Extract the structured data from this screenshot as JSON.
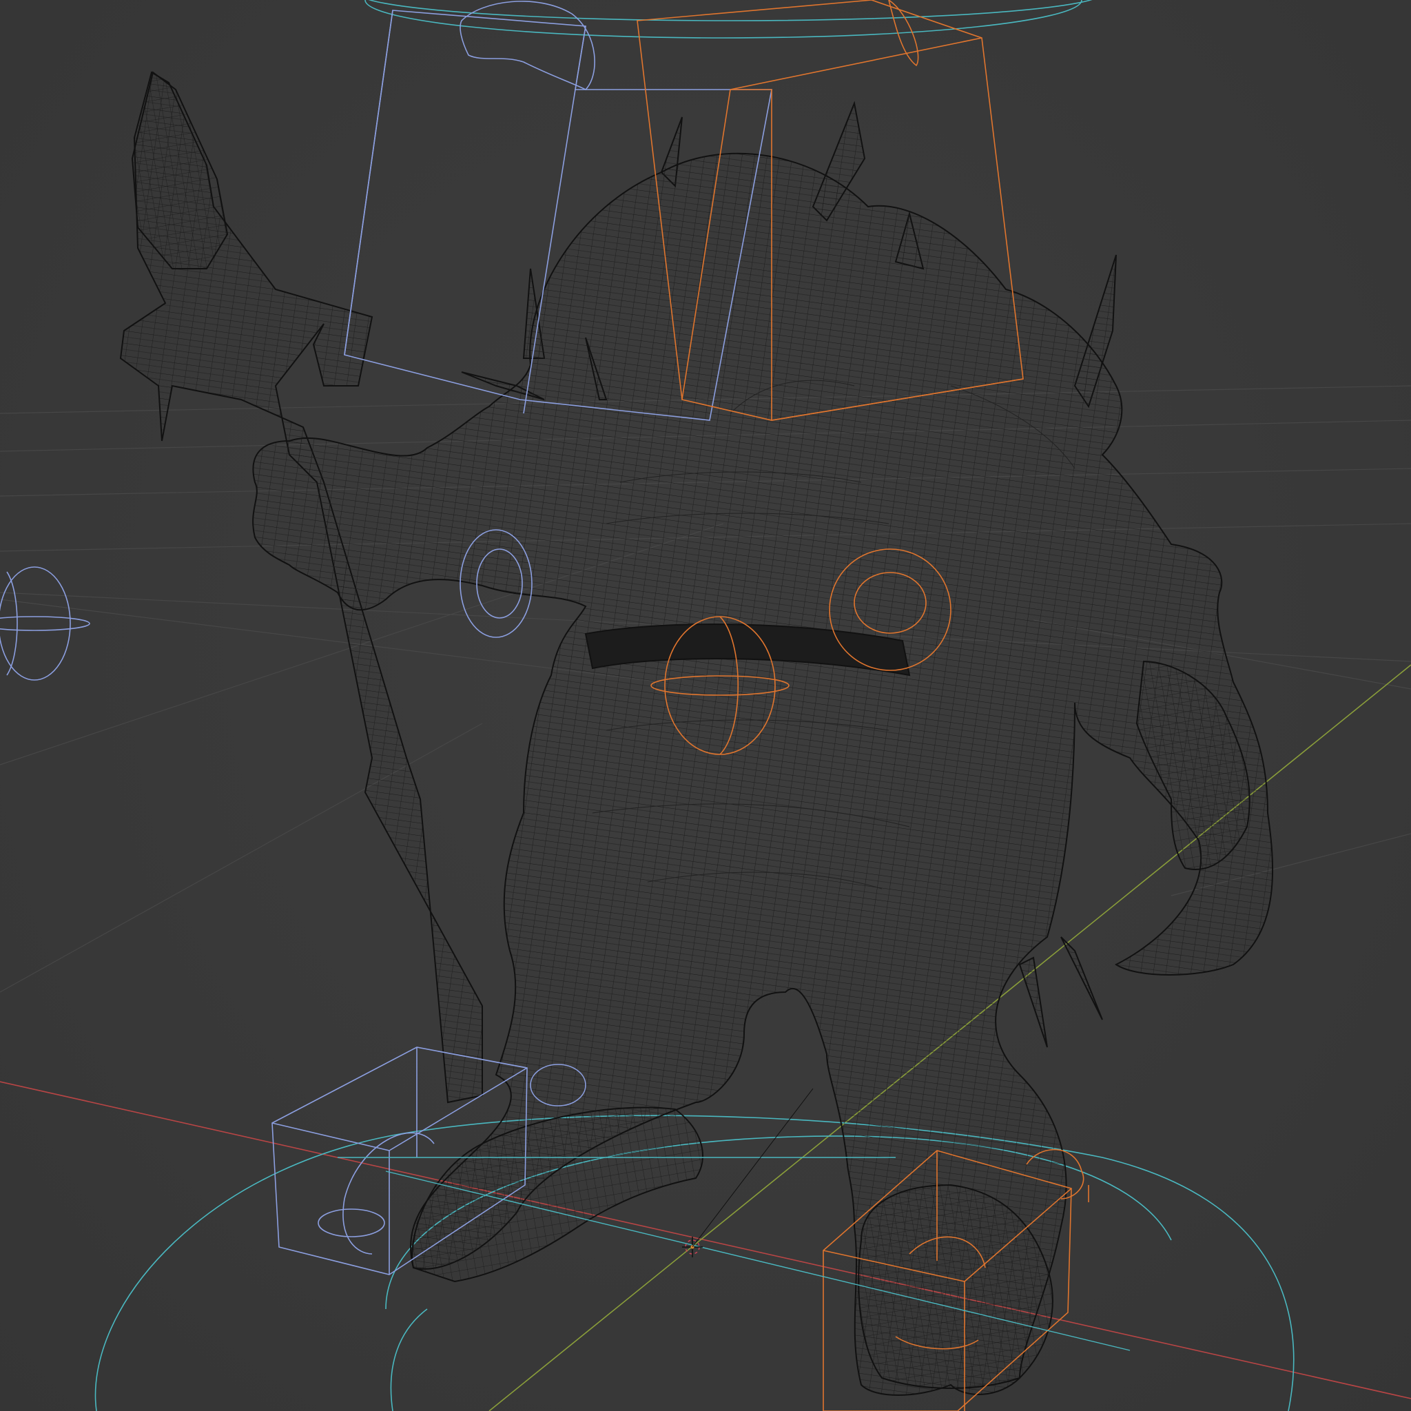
{
  "viewport": {
    "background": "#393939",
    "grid_color": "#4a4a4a",
    "axis_x_color": "#c24a4a",
    "axis_y_color": "#8ea33a"
  },
  "rig": {
    "left_controls_color": "#8c9fe0",
    "right_controls_color": "#e0752e",
    "root_controls_color": "#4ab8c0",
    "mesh_color": "#141414"
  },
  "icons": {
    "origin": "3d-cursor-icon"
  }
}
